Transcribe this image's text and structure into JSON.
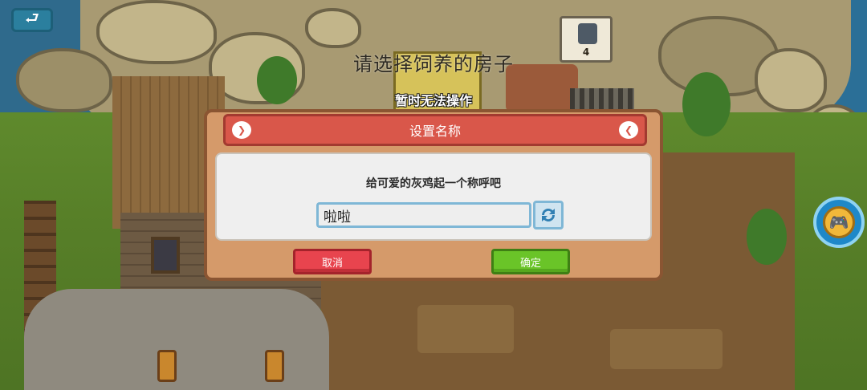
{
  "hud": {
    "back_label": "⮐",
    "prompt_title": "请选择饲养的房子",
    "prompt_subtitle": "暂时无法操作",
    "counter_value": "4",
    "gamepad_icon": "🎮"
  },
  "dialog": {
    "title": "设置名称",
    "message": "给可爱的灰鸡起一个称呼吧",
    "name_value": "啦啦",
    "cancel_label": "取消",
    "confirm_label": "确定",
    "deco_left": "❯",
    "deco_right": "❮"
  },
  "colors": {
    "header_red": "#d9574a",
    "cancel_red": "#e8444e",
    "confirm_green": "#6ac428",
    "input_border_blue": "#7fb7d6"
  }
}
